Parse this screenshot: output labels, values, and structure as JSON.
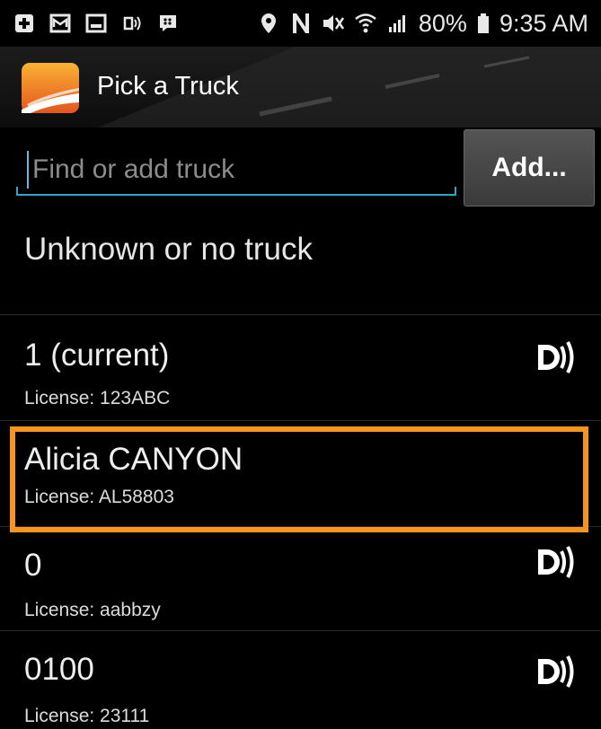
{
  "status_bar": {
    "battery": "80%",
    "time": "9:35 AM",
    "icons": [
      "plus-box-icon",
      "mail-icon",
      "image-icon",
      "cast-icon",
      "blackberry-icon",
      "location-icon",
      "nfc-icon",
      "mute-icon",
      "wifi-icon",
      "signal-icon",
      "battery-icon"
    ]
  },
  "action_bar": {
    "title": "Pick a Truck",
    "logo_icon": "road-logo-icon"
  },
  "search": {
    "placeholder": "Find or add truck",
    "value": "",
    "add_label": "Add..."
  },
  "list": {
    "unknown_label": "Unknown or no truck",
    "trucks": [
      {
        "name": "1 (current)",
        "license": "License: 123ABC",
        "has_device_icon": true
      },
      {
        "name": "Alicia CANYON",
        "license": "License: AL58803",
        "has_device_icon": false,
        "highlighted": true
      },
      {
        "name": "0",
        "license": "License: aabbzy",
        "has_device_icon": true
      },
      {
        "name": "0100",
        "license": "License: 23111",
        "has_device_icon": true
      }
    ]
  },
  "colors": {
    "highlight": "#f7941d",
    "accent": "#2fa4c9",
    "background": "#000000"
  }
}
